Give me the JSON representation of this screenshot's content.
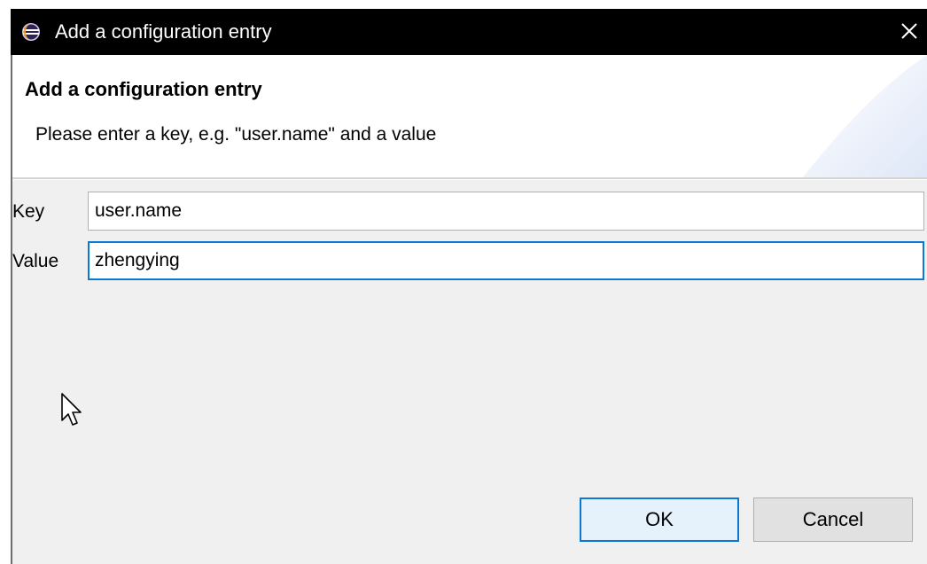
{
  "window": {
    "title": "Add a configuration entry",
    "close_glyph": "✕"
  },
  "banner": {
    "title": "Add a configuration entry",
    "message": "Please enter a key, e.g. \"user.name\" and a value"
  },
  "form": {
    "key_label": "Key",
    "key_value": "user.name",
    "value_label": "Value",
    "value_value": "zhengying"
  },
  "buttons": {
    "ok_label": "OK",
    "cancel_label": "Cancel"
  },
  "icons": {
    "app": "eclipse-icon",
    "close": "close-icon",
    "cursor": "mouse-pointer-icon"
  },
  "colors": {
    "title_bar": "#000000",
    "dialog_bg": "#f0f0f0",
    "focus_accent": "#0a78d7"
  }
}
